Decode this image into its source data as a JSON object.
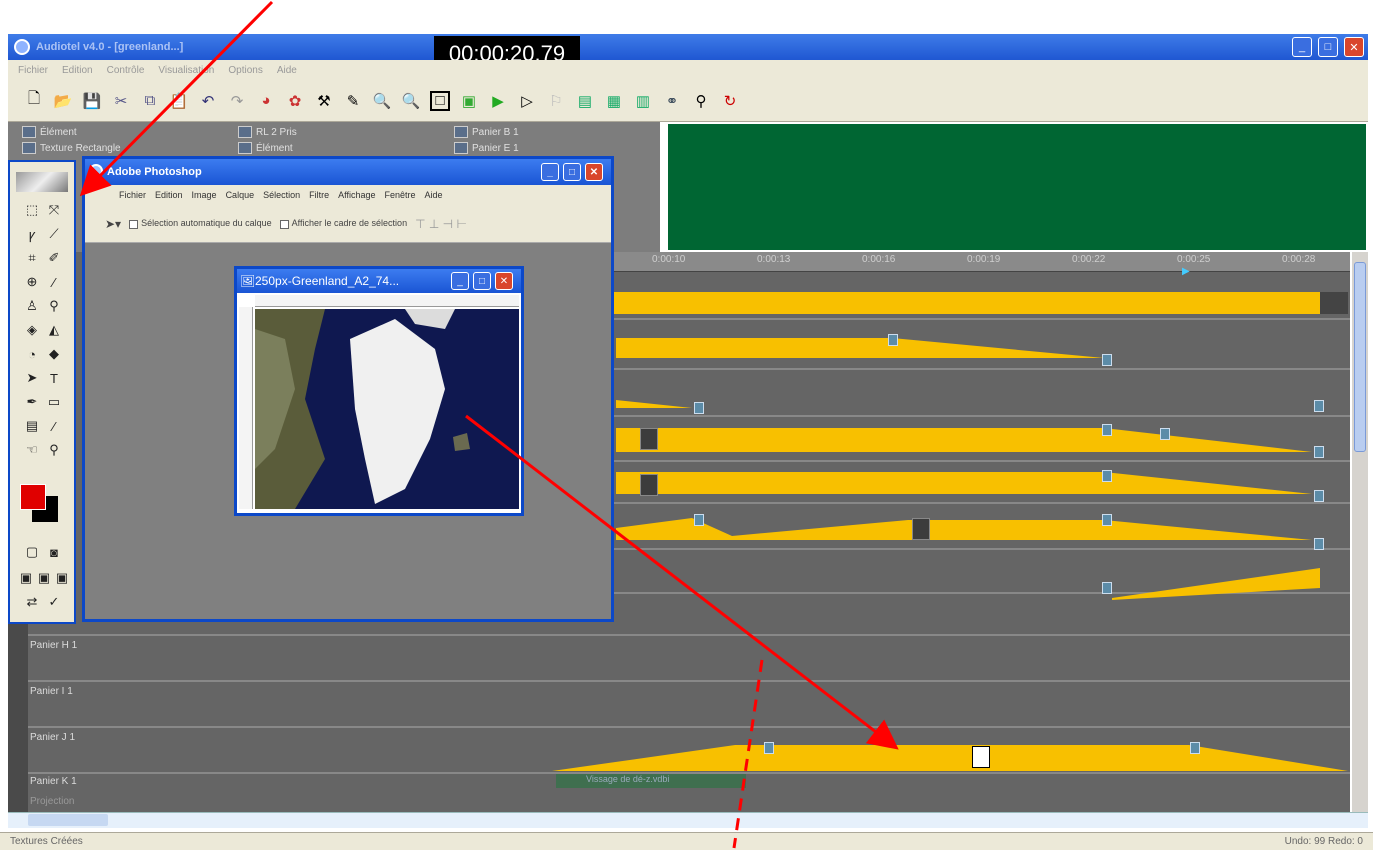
{
  "app": {
    "title": "Audiotel v4.0 - [greenland...]",
    "clock": "00:00:20.79",
    "menu": [
      "Fichier",
      "Edition",
      "Contrôle",
      "Visualisation",
      "Options",
      "Aide"
    ],
    "toolbar_icons": [
      "new-icon",
      "open-icon",
      "save-icon",
      "cut-icon",
      "copy-icon",
      "paste-icon",
      "undo-icon",
      "redo-icon",
      "color-icon",
      "paint-icon",
      "tool-icon",
      "pen-icon",
      "zoom-out-icon",
      "zoom-in-icon",
      "select-icon",
      "frame-icon",
      "play-icon",
      "step-icon",
      "marker-icon",
      "track1-icon",
      "track2-icon",
      "track3-icon",
      "link-icon",
      "wand-icon",
      "loop-icon"
    ]
  },
  "media": {
    "items": [
      "Élément",
      "Texture Rectangle",
      "RL 2 Pris",
      "Élément",
      "Panier B 1",
      "Panier E 1"
    ]
  },
  "timeline": {
    "ruler_labels": [
      "0:00:10",
      "0:00:13",
      "0:00:16",
      "0:00:19",
      "0:00:22",
      "0:00:25",
      "0:00:28"
    ],
    "track_labels": [
      "Panier H 1",
      "Panier I 1",
      "Panier J 1",
      "Panier K 1",
      "Projection"
    ],
    "clip_caption": "Vissage de dé-z.vdbi"
  },
  "photoshop": {
    "title": "Adobe Photoshop",
    "menu": [
      "Fichier",
      "Edition",
      "Image",
      "Calque",
      "Sélection",
      "Filtre",
      "Affichage",
      "Fenêtre",
      "Aide"
    ],
    "options": {
      "auto_select": "Sélection automatique du calque",
      "show_bounds": "Afficher le cadre de sélection"
    },
    "image_window_title": "250px-Greenland_A2_74...",
    "colors": {
      "foreground": "#e00000",
      "background": "#000000"
    }
  },
  "status": {
    "left": "Textures Créées",
    "right": "Undo: 99   Redo: 0"
  },
  "annotations": {
    "arrow_color": "#ff0000"
  }
}
